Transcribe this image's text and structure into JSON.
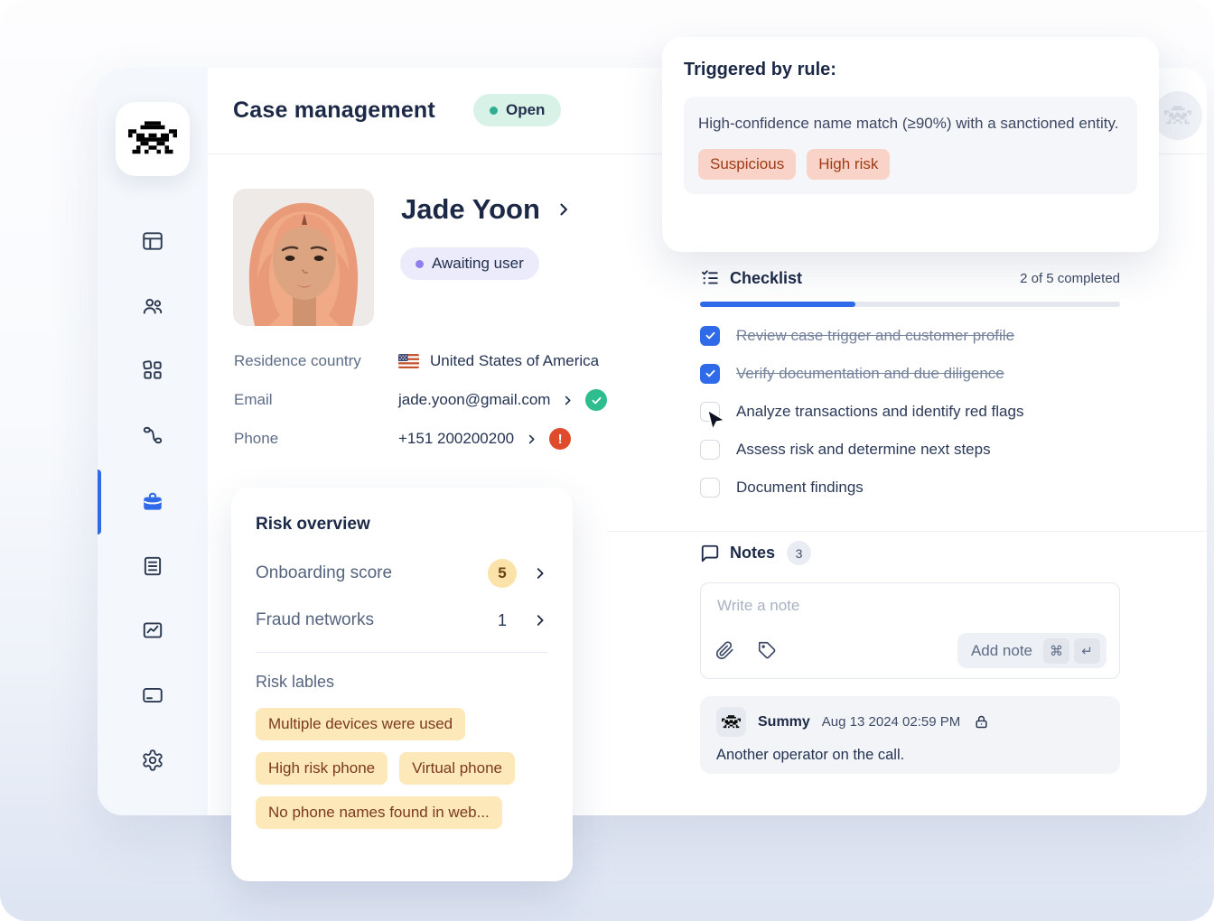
{
  "header": {
    "title": "Case management",
    "status_label": "Open"
  },
  "profile": {
    "name": "Jade Yoon",
    "status_label": "Awaiting user",
    "residence_label": "Residence country",
    "residence_value": "United States of America",
    "email_label": "Email",
    "email_value": "jade.yoon@gmail.com",
    "phone_label": "Phone",
    "phone_value": "+151 200200200"
  },
  "risk_overview": {
    "title": "Risk overview",
    "rows": [
      {
        "label": "Onboarding score",
        "value": "5"
      },
      {
        "label": "Fraud networks",
        "value": "1"
      }
    ],
    "labels_title": "Risk lables",
    "tags": [
      "Multiple devices were used",
      "High risk phone",
      "Virtual phone",
      "No phone names found in web..."
    ]
  },
  "triggered_rule": {
    "title": "Triggered by rule:",
    "description": "High-confidence name match (≥90%) with a sanctioned entity.",
    "tags": [
      "Suspicious",
      "High risk"
    ]
  },
  "checklist": {
    "title": "Checklist",
    "progress_label": "2 of 5 completed",
    "progress_percent": 37,
    "items": [
      {
        "label": "Review case trigger and customer profile",
        "checked": true
      },
      {
        "label": "Verify documentation and due diligence",
        "checked": true
      },
      {
        "label": "Analyze transactions and identify red flags",
        "checked": false
      },
      {
        "label": "Assess risk and determine next steps",
        "checked": false
      },
      {
        "label": "Document findings",
        "checked": false
      }
    ]
  },
  "notes": {
    "title": "Notes",
    "count": "3",
    "composer_placeholder": "Write a note",
    "add_button_label": "Add note",
    "shortcut_keys": [
      "⌘",
      "↵"
    ],
    "entries": [
      {
        "author": "Summy",
        "timestamp": "Aug 13 2024 02:59 PM",
        "text": "Another operator on the call."
      }
    ]
  },
  "colors": {
    "accent_blue": "#2f6be8",
    "success_green": "#2dbd8e",
    "error_red": "#df4b2b",
    "open_badge_bg": "#d8f2e8",
    "awaiting_badge_bg": "#ecebfc",
    "amber_tag_bg": "#fce8b8",
    "pink_tag_bg": "#f9d3c7"
  }
}
